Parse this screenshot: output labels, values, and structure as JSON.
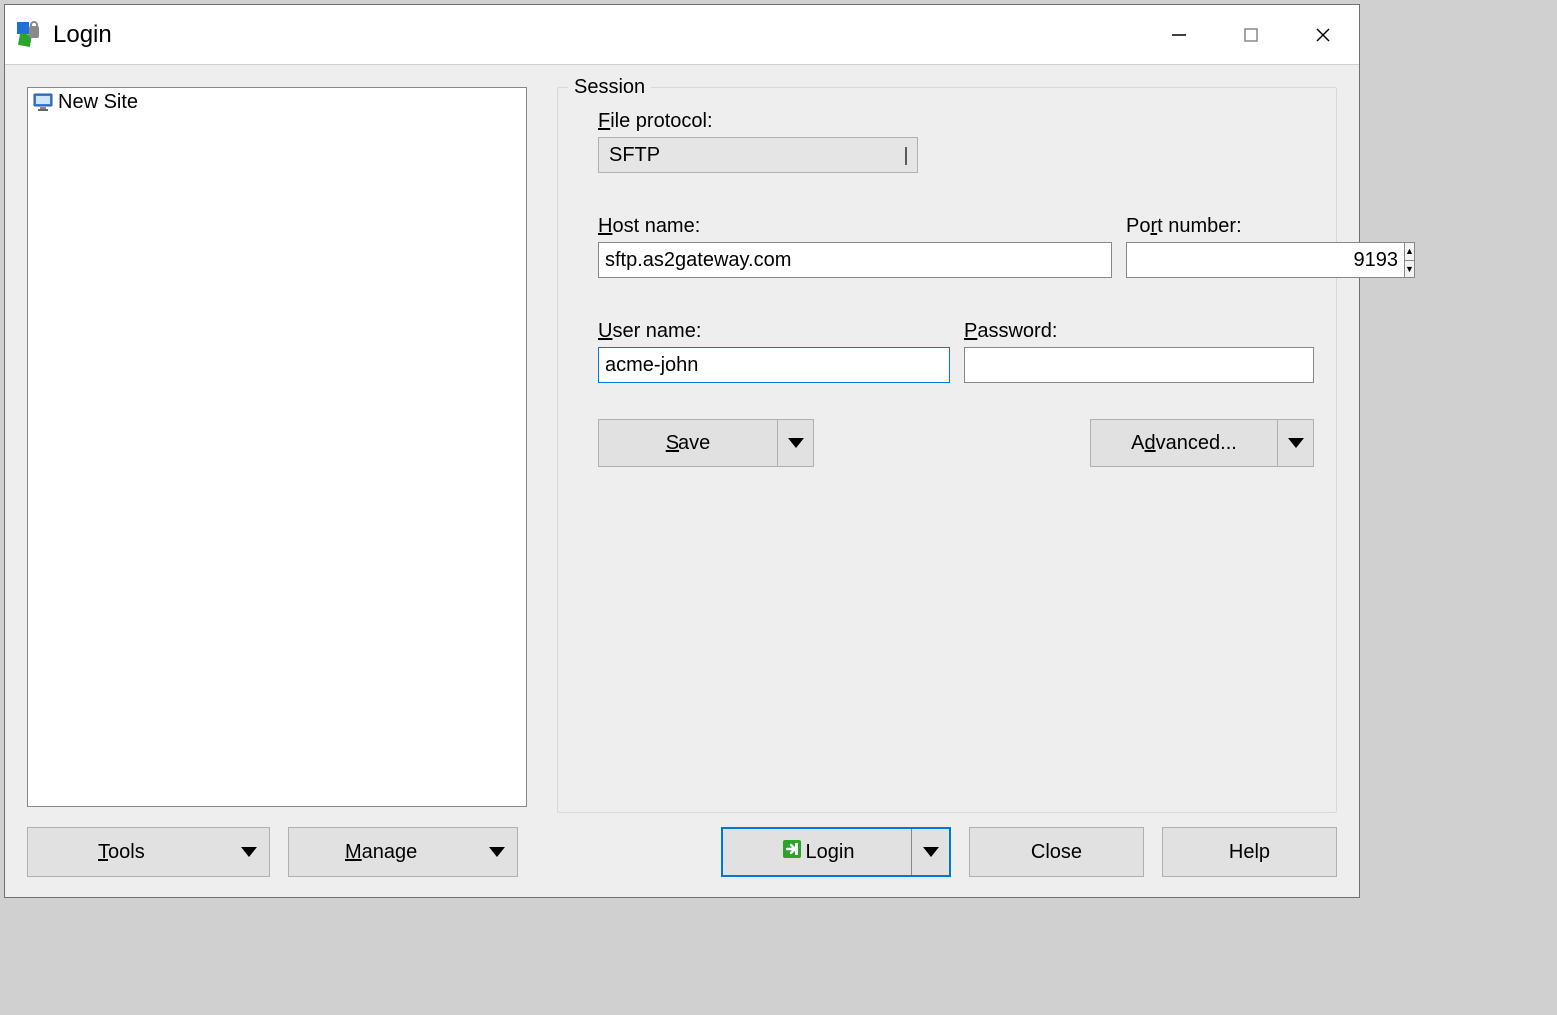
{
  "window": {
    "title": "Login"
  },
  "sites": {
    "items": [
      {
        "label": "New Site"
      }
    ]
  },
  "session": {
    "legend": "Session",
    "file_protocol_label": "File protocol:",
    "file_protocol_value": "SFTP",
    "host_label": "Host name:",
    "host_value": "sftp.as2gateway.com",
    "port_label": "Port number:",
    "port_value": "9193",
    "user_label": "User name:",
    "user_value": "acme-john",
    "password_label": "Password:",
    "password_value": "",
    "save_label": "Save",
    "advanced_label": "Advanced..."
  },
  "bottom": {
    "tools": "Tools",
    "manage": "Manage",
    "login": "Login",
    "close": "Close",
    "help": "Help"
  }
}
